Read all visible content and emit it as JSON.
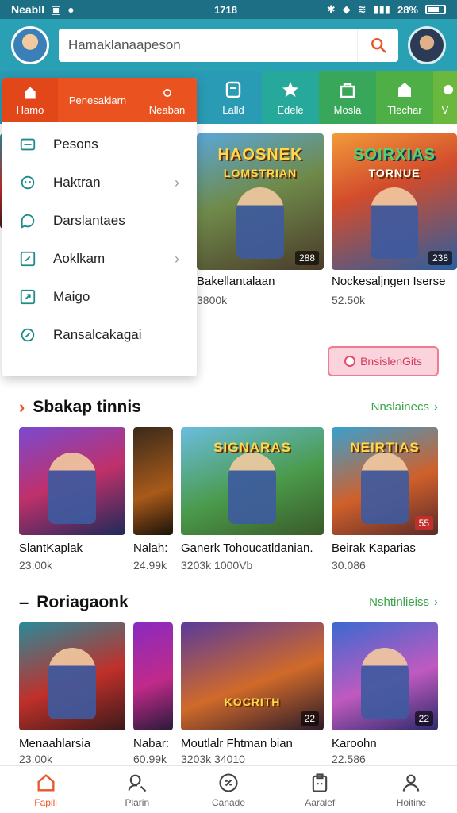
{
  "status_bar": {
    "carrier": "Neabll",
    "time": "1718",
    "battery": "28%"
  },
  "header": {
    "search_placeholder": "Hamaklanaapeson"
  },
  "category_tabs": [
    {
      "label": "Lalld",
      "icon": "bookmark-icon"
    },
    {
      "label": "Edele",
      "icon": "star-icon"
    },
    {
      "label": "Mosla",
      "icon": "store-icon"
    },
    {
      "label": "Tlechar",
      "icon": "home-icon"
    },
    {
      "label": "V",
      "icon": "tag-icon"
    }
  ],
  "menu": {
    "tabs": [
      {
        "label": "Hamo",
        "icon": "home-icon"
      },
      {
        "label": "Penesakiarn",
        "icon": ""
      },
      {
        "label": "Neaban",
        "icon": "circle-icon"
      }
    ],
    "items": [
      {
        "label": "Pesons",
        "icon": "mail-icon",
        "has_arrow": false
      },
      {
        "label": "Haktran",
        "icon": "face-icon",
        "has_arrow": true
      },
      {
        "label": "Darslantaes",
        "icon": "chat-icon",
        "has_arrow": false
      },
      {
        "label": "Aoklkam",
        "icon": "edit-icon",
        "has_arrow": true
      },
      {
        "label": "Maigo",
        "icon": "expand-icon",
        "has_arrow": false
      },
      {
        "label": "Ransalcakagai",
        "icon": "compass-icon",
        "has_arrow": false
      }
    ]
  },
  "featured": [
    {
      "title": "HAOSNEK",
      "subtitle": "LOMSTRIAN",
      "badge": "288",
      "name": "Bakellantalaan",
      "count": "3800k"
    },
    {
      "title": "SOIRXIAS",
      "subtitle": "TORNUE",
      "badge": "238",
      "name": "Nockesaljngen Iserse",
      "count": "52.50k"
    }
  ],
  "pill_button": "BnsislenGits",
  "section1": {
    "title": "Sbakap tinnis",
    "more": "Nnslainecs",
    "items": [
      {
        "name": "SlantKaplak",
        "count": "23.00k",
        "badge": ""
      },
      {
        "name": "Nalah:",
        "count": "24.99k",
        "badge": ""
      },
      {
        "name": "Ganerk Tohoucatldanian.",
        "count": "3203k  1000Vb",
        "badge": "",
        "title": "SIGNARAS"
      },
      {
        "name": "Beirak Kaparias",
        "count": "30.086",
        "badge": "55",
        "title": "NEIRTIAS"
      }
    ]
  },
  "section2": {
    "title": "Roriagaonk",
    "more": "Nshtinlieiss",
    "items": [
      {
        "name": "Menaahlarsia",
        "count": "23.00k",
        "badge": ""
      },
      {
        "name": "Nabar:",
        "count": "60.99k",
        "badge": ""
      },
      {
        "name": "Moutlalr Fhtman bian",
        "count": "3203k  34010",
        "badge": "22",
        "title": "KOCRITH"
      },
      {
        "name": "Karoohn",
        "count": "22.586",
        "badge": "22"
      }
    ]
  },
  "bottom_nav": [
    {
      "label": "Fapili",
      "icon": "home-icon",
      "active": true
    },
    {
      "label": "Plarin",
      "icon": "user-search-icon",
      "active": false
    },
    {
      "label": "Canade",
      "icon": "compass-icon",
      "active": false
    },
    {
      "label": "Aaralef",
      "icon": "clipboard-icon",
      "active": false
    },
    {
      "label": "Hoitine",
      "icon": "profile-icon",
      "active": false
    }
  ],
  "colors": {
    "header": "#2aa0b4",
    "menu_accent": "#ea531f",
    "link_green": "#3aa34a",
    "active_nav": "#e8562a"
  }
}
